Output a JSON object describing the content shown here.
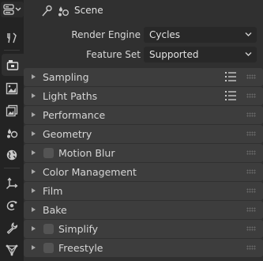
{
  "header": {
    "scene_label": "Scene"
  },
  "tabs": [
    {
      "name": "tool-tab",
      "icon": "tool-icon"
    },
    {
      "name": "render-tab",
      "icon": "render-camera-icon",
      "active": true
    },
    {
      "name": "output-tab",
      "icon": "output-image-icon"
    },
    {
      "name": "view-layer-tab",
      "icon": "view-layer-icon"
    },
    {
      "name": "scene-tab",
      "icon": "scene-icon"
    },
    {
      "name": "world-tab",
      "icon": "world-icon"
    },
    {
      "name": "object-tab",
      "icon": "object-axes-icon"
    },
    {
      "name": "physics-tab",
      "icon": "physics-orbit-icon"
    },
    {
      "name": "constraints-tab",
      "icon": "wrench-icon"
    },
    {
      "name": "data-tab",
      "icon": "mesh-data-icon"
    }
  ],
  "render": {
    "engine_label": "Render Engine",
    "engine_value": "Cycles",
    "feature_set_label": "Feature Set",
    "feature_set_value": "Supported"
  },
  "panels": [
    {
      "title": "Sampling",
      "presets": true,
      "checkbox": false
    },
    {
      "title": "Light Paths",
      "presets": true,
      "checkbox": false
    },
    {
      "title": "Performance",
      "presets": false,
      "checkbox": false
    },
    {
      "title": "Geometry",
      "presets": false,
      "checkbox": false
    },
    {
      "title": "Motion Blur",
      "presets": false,
      "checkbox": true,
      "checked": false
    },
    {
      "title": "Color Management",
      "presets": false,
      "checkbox": false
    },
    {
      "title": "Film",
      "presets": false,
      "checkbox": false
    },
    {
      "title": "Bake",
      "presets": false,
      "checkbox": false
    },
    {
      "title": "Simplify",
      "presets": false,
      "checkbox": true,
      "checked": false
    },
    {
      "title": "Freestyle",
      "presets": false,
      "checkbox": true,
      "checked": false
    }
  ],
  "colors": {
    "background": "#303030",
    "panel_header": "#3d3d3d",
    "tab_bar": "#232323",
    "dropdown": "#282828"
  }
}
